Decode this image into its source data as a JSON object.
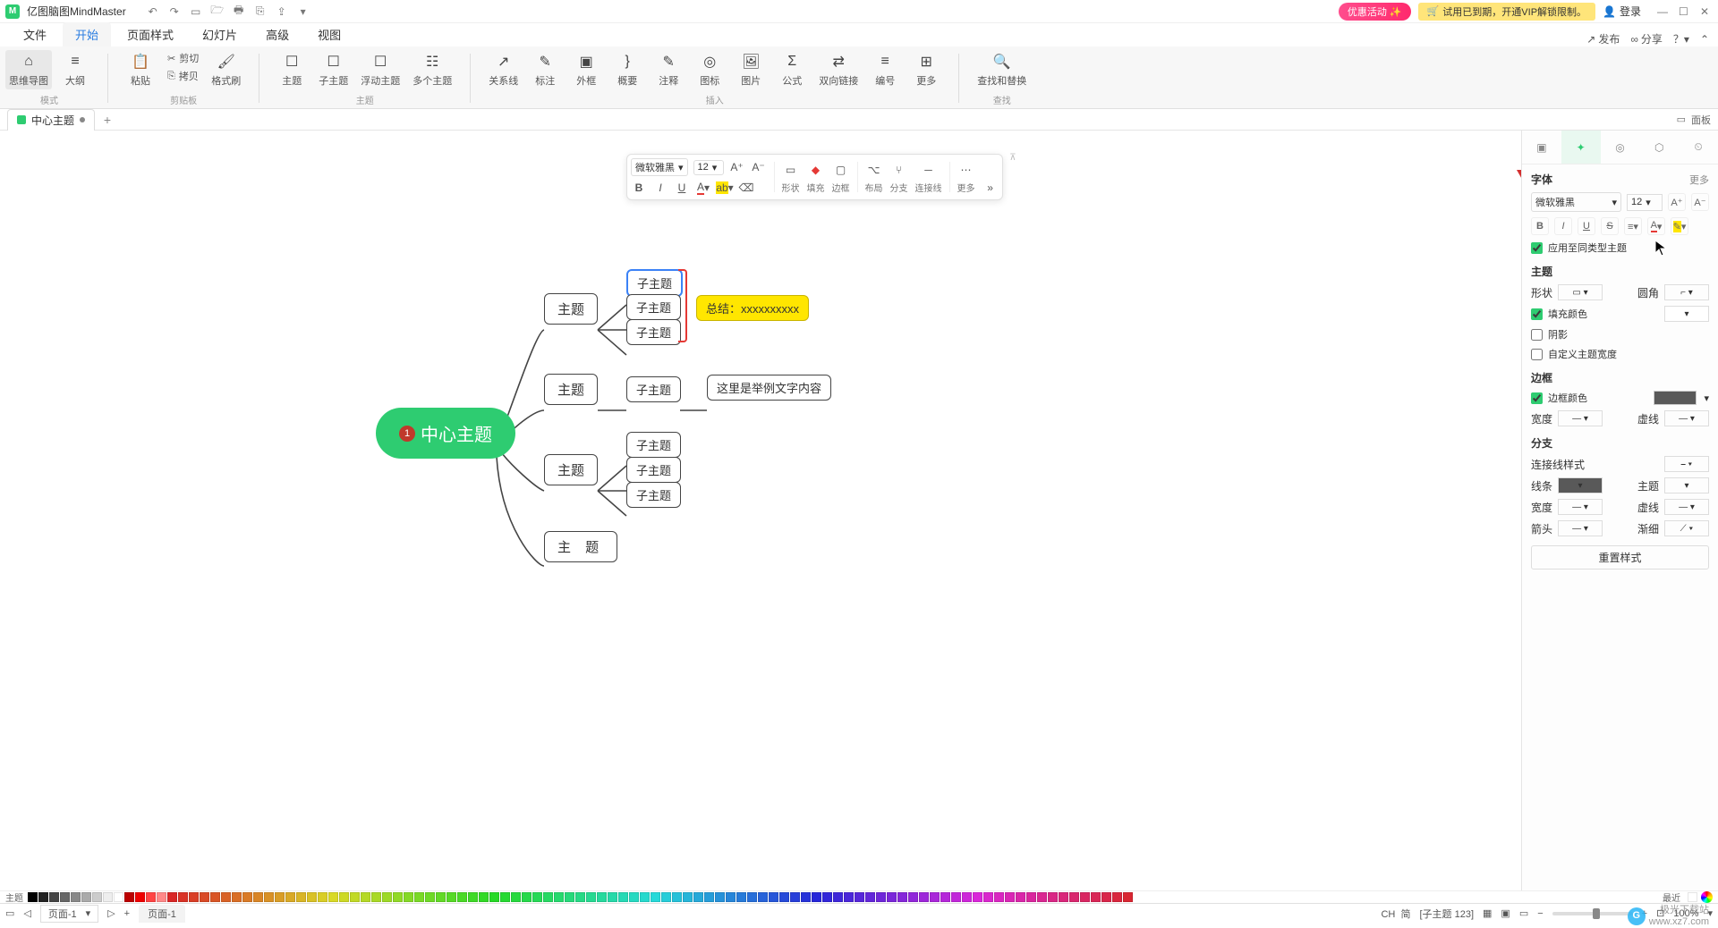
{
  "titlebar": {
    "app_name": "亿图脑图MindMaster",
    "promo": "优惠活动",
    "trial": "试用已到期，开通VIP解锁限制。",
    "login": "登录"
  },
  "menubar": {
    "items": [
      "文件",
      "开始",
      "页面样式",
      "幻灯片",
      "高级",
      "视图"
    ],
    "active_index": 1,
    "publish": "发布",
    "share": "分享"
  },
  "ribbon": {
    "mode": {
      "mindmap": "思维导图",
      "outline": "大纲",
      "group": "模式"
    },
    "clipboard": {
      "paste": "粘贴",
      "cut": "剪切",
      "copy": "拷贝",
      "formatbrush": "格式刷",
      "group": "剪贴板"
    },
    "topic": {
      "topic": "主题",
      "subtopic": "子主题",
      "floating": "浮动主题",
      "multiple": "多个主题",
      "group": "主题"
    },
    "insert": {
      "relation": "关系线",
      "callout": "标注",
      "boundary": "外框",
      "summary": "概要",
      "comment": "注释",
      "icon": "图标",
      "image": "图片",
      "formula": "公式",
      "hyperlink": "双向链接",
      "number": "编号",
      "more": "更多",
      "group": "插入"
    },
    "find": {
      "findreplace": "查找和替换",
      "group": "查找"
    }
  },
  "doctabs": {
    "name": "中心主题",
    "panel": "面板"
  },
  "mindmap": {
    "center": "中心主题",
    "badge": "1",
    "mains": [
      "主题",
      "主题",
      "主题",
      "主 题"
    ],
    "subs1": [
      "子主题",
      "子主题",
      "子主题"
    ],
    "sub2": "子主题",
    "subs3": [
      "子主题",
      "子主题",
      "子主题"
    ],
    "note_yellow": "总结：xxxxxxxxxx",
    "note_white": "这里是举例文字内容"
  },
  "float_toolbar": {
    "font": "微软雅黑",
    "size": "12",
    "shape": "形状",
    "fill": "填充",
    "border": "边框",
    "layout": "布局",
    "branch": "分支",
    "connector": "连接线",
    "more": "更多"
  },
  "right_panel": {
    "font_section": "字体",
    "more": "更多",
    "font": "微软雅黑",
    "size": "12",
    "apply_same": "应用至同类型主题",
    "topic_section": "主题",
    "shape": "形状",
    "corner": "圆角",
    "fill": "填充颜色",
    "shadow": "阴影",
    "custom_width": "自定义主题宽度",
    "border_section": "边框",
    "border_color": "边框颜色",
    "width": "宽度",
    "dash": "虚线",
    "branch_section": "分支",
    "conn_style": "连接线样式",
    "line": "线条",
    "theme": "主题",
    "arrow": "箭头",
    "taper": "渐细",
    "reset": "重置样式"
  },
  "colorbar": {
    "theme": "主题",
    "recent": "最近"
  },
  "status": {
    "page_sel": "页面-1",
    "page_tab": "页面-1",
    "ime": "CH 󠀥 简",
    "node_info": "[子主题 123]",
    "zoom": "100%"
  },
  "watermark": {
    "l1": "极光下载站",
    "l2": "www.xz7.com"
  }
}
